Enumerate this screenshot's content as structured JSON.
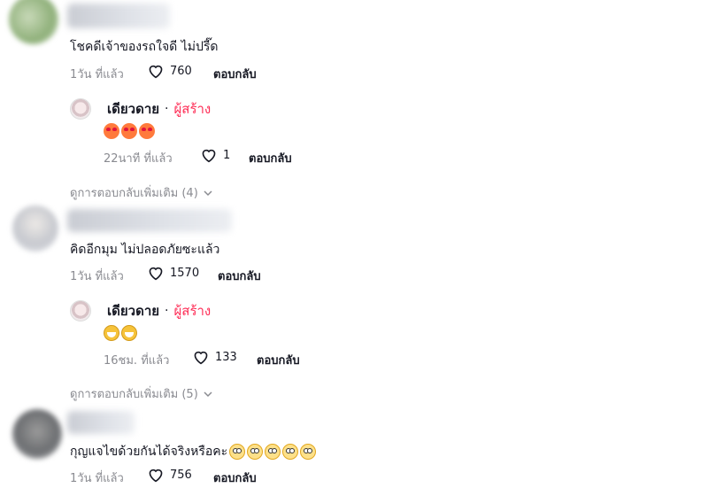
{
  "comments": [
    {
      "text": "โชคดีเจ้าของรถใจดี ไม่ปรี๊ด",
      "time": "1วัน ที่แล้ว",
      "likes": "760",
      "reply_label": "ตอบกลับ",
      "creator_reply": {
        "name": "เดียวดาย",
        "dot": "·",
        "tag": "ผู้สร้าง",
        "emojis": [
          "heart-eyes-emoji",
          "heart-eyes-emoji",
          "heart-eyes-emoji"
        ],
        "time": "22นาที ที่แล้ว",
        "likes": "1",
        "reply_label": "ตอบกลับ"
      },
      "more_replies": "ดูการตอบกลับเพิ่มเติม (4)"
    },
    {
      "text": "คิดอีกมุม ไม่ปลอดภัยซะแล้ว",
      "time": "1วัน ที่แล้ว",
      "likes": "1570",
      "reply_label": "ตอบกลับ",
      "creator_reply": {
        "name": "เดียวดาย",
        "dot": "·",
        "tag": "ผู้สร้าง",
        "emojis": [
          "tears-of-joy-emoji",
          "tears-of-joy-emoji"
        ],
        "time": "16ชม. ที่แล้ว",
        "likes": "133",
        "reply_label": "ตอบกลับ"
      },
      "more_replies": "ดูการตอบกลับเพิ่มเติม (5)"
    },
    {
      "text": "กุญแจไขด้วยกันได้จริงหรือคะ",
      "emojis": [
        "flushed-emoji",
        "flushed-emoji",
        "flushed-emoji",
        "flushed-emoji",
        "flushed-emoji"
      ],
      "time": "1วัน ที่แล้ว",
      "likes": "756",
      "reply_label": "ตอบกลับ"
    }
  ],
  "colors": {
    "creator_tag": "#fe2c55",
    "meta_text": "#8a8b91",
    "primary_text": "#161823"
  }
}
